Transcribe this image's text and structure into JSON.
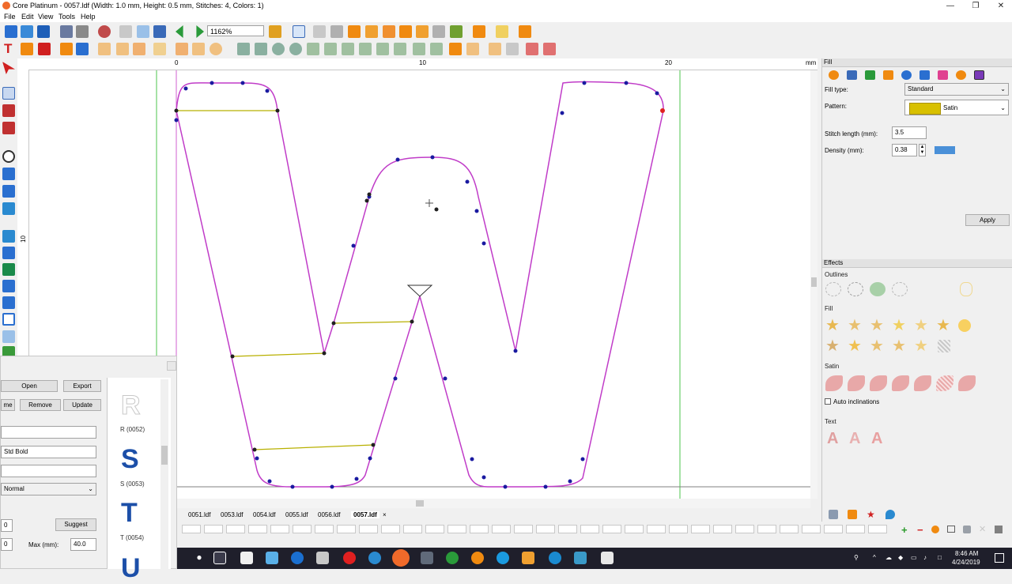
{
  "window": {
    "title": "Core Platinum - 0057.ldf (Width: 1.0 mm, Height: 0.5 mm, Stitches: 4, Colors: 1)",
    "controls": [
      "—",
      "❐",
      "✕"
    ]
  },
  "menu": [
    "File",
    "Edit",
    "View",
    "Tools",
    "Help"
  ],
  "toolbar": {
    "zoom": "1162%"
  },
  "ruler": {
    "unit": "mm",
    "top_ticks": [
      "0",
      "10",
      "20"
    ],
    "left_ticks": [
      "10"
    ]
  },
  "tabs": [
    "0051.ldf",
    "0053.ldf",
    "0054.ldf",
    "0055.ldf",
    "0056.ldf",
    "0057.ldf"
  ],
  "active_tab": "0057.ldf",
  "tab_close": "×",
  "fill_panel": {
    "header": "Fill",
    "fill_type_label": "Fill type:",
    "fill_type_value": "Standard",
    "pattern_label": "Pattern:",
    "pattern_value": "Satin",
    "stitch_length_label": "Stitch length (mm):",
    "stitch_length_value": "3.5",
    "density_label": "Density (mm):",
    "density_value": "0.38",
    "apply_label": "Apply"
  },
  "effects_panel": {
    "header": "Effects",
    "outlines_label": "Outlines",
    "fill_label": "Fill",
    "satin_label": "Satin",
    "auto_inclinations_label": "Auto inclinations",
    "text_label": "Text",
    "text_glyph": "A"
  },
  "font_panel": {
    "open_label": "Open",
    "export_label": "Export",
    "rename_label": "me",
    "remove_label": "Remove",
    "update_label": "Update",
    "font_name": "Std Bold",
    "style": "Normal",
    "suggest_label": "Suggest",
    "max_label": "Max (mm):",
    "max_value": "40.0",
    "field_a": "0",
    "field_b": "0",
    "glyphs": [
      {
        "char": "R",
        "label": "R (0052)"
      },
      {
        "char": "S",
        "label": "S (0053)"
      },
      {
        "char": "T",
        "label": "T (0054)"
      },
      {
        "char": "U",
        "label": ""
      }
    ]
  },
  "taskbar": {
    "time": "8:46 AM",
    "date": "4/24/2019"
  },
  "colors": {
    "outline": "#c03cc8",
    "node": "#1a1aa0",
    "stitch": "#b8b000",
    "guide": "#4cc44c",
    "glyph_blue": "#1c4fa8",
    "apply_bg": "#e1e1e1"
  }
}
